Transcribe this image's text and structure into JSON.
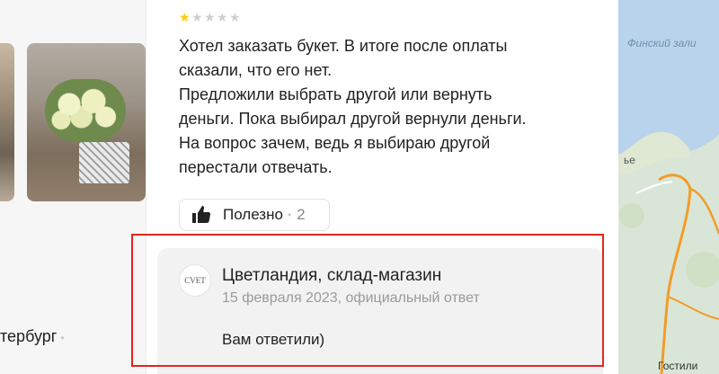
{
  "left_panel": {
    "city_text": "тербург",
    "separator": "•"
  },
  "review": {
    "rating": 1,
    "rating_max": 5,
    "star_colors": {
      "on": "#ffcc00",
      "off": "#cfcfcf"
    },
    "text_lines": [
      "Хотел заказать букет. В итоге после оплаты",
      "сказали, что его нет.",
      "Предложили выбрать другой или вернуть",
      "деньги. Пока выбирал другой вернули деньги.",
      "На вопрос зачем, ведь я выбираю другой",
      "перестали отвечать."
    ],
    "useful": {
      "label": "Полезно",
      "separator": "•",
      "count": "2",
      "icon": "thumbs-up-icon"
    }
  },
  "answer": {
    "avatar_text": "CVET",
    "org_name": "Цветландия, склад-магазин",
    "meta": "15 февраля 2023, официальный ответ",
    "text": "Вам ответили)"
  },
  "map": {
    "sea_label": "Финский зали",
    "fragment_label": "ье",
    "bottom_label": "Гостили",
    "colors": {
      "water": "#b9d3ec",
      "land": "#d9e6d7",
      "road": "#f29c2b"
    }
  },
  "highlight_color": "#e3251f"
}
